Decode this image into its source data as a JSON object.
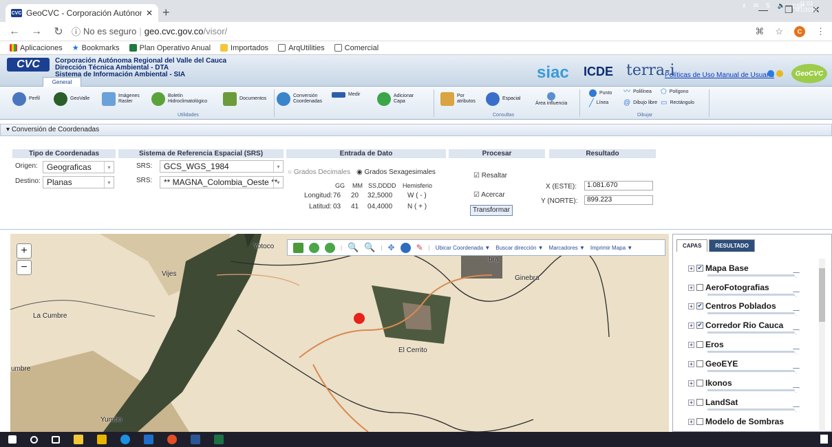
{
  "browser": {
    "tab_title": "GeoCVC - Corporación Autónom",
    "new_tab": "+",
    "security": "No es seguro",
    "url_domain": "geo.cvc.gov.co",
    "url_path": "/visor/",
    "bookmarks": [
      "Aplicaciones",
      "Bookmarks",
      "Plan Operativo Anual",
      "Importados",
      "ArqUtilities",
      "Comercial"
    ],
    "profile_initial": "C"
  },
  "header": {
    "logo": "CVC",
    "org_line1": "Corporación Autónoma Regional del Valle del Cauca",
    "org_line2": "Dirección Técnica Ambiental - DTA",
    "org_line3": "Sistema de Información Ambiental - SIA",
    "tab_general": "General",
    "siac": "siac",
    "icde": "ICDE",
    "terra": "terra-i",
    "link_policies": "Políticas de Uso",
    "link_manual": "Manual de Usuario",
    "geocvc": "GeoCVC"
  },
  "toolbar": {
    "perfil": "Perfil",
    "geovalle": "GeoValle",
    "imagenes": "Imágenes Raster",
    "boletin": "Boletín Hidroclimatológico",
    "documentos": "Documentos",
    "utilidades": "Utilidades",
    "conversion": "Conversión Coordenadas",
    "medir": "Medir",
    "adicionar": "Adicionar Capa",
    "por_atributos": "Por atributos",
    "espacial": "Espacial",
    "consultas": "Consultas",
    "area_influencia": "Área influencia",
    "punto": "Punto",
    "linea": "Línea",
    "polilinea": "Polilínea",
    "dibujo_libre": "Dibujo libre",
    "dibujar": "Dibujar",
    "poligono": "Polígono",
    "rectangulo": "Rectángulo"
  },
  "conversion": {
    "panel_title": "Conversión de Coordenadas",
    "h_tipo": "Tipo de Coordenadas",
    "h_srs": "Sistema de Referencia Espacial (SRS)",
    "h_entrada": "Entrada de Dato",
    "h_procesar": "Procesar",
    "h_resultado": "Resultado",
    "origen_label": "Origen:",
    "origen_value": "Geograficas",
    "destino_label": "Destino:",
    "destino_value": "Planas",
    "srs_label": "SRS:",
    "srs_origen": "GCS_WGS_1984",
    "srs_destino": "** MAGNA_Colombia_Oeste **",
    "opt_decimales": "Grados Decimales",
    "opt_sexagesimales": "Grados Sexagesimales",
    "col_gg": "GG",
    "col_mm": "MM",
    "col_ss": "SS,DDDD",
    "col_hem": "Hemisferio",
    "longitud_label": "Longitud:",
    "lon_gg": "76",
    "lon_mm": "20",
    "lon_ss": "32,5000",
    "lon_hem": "W ( - )",
    "latitud_label": "Latitud:",
    "lat_gg": "03",
    "lat_mm": "41",
    "lat_ss": "04,4000",
    "lat_hem": "N ( + )",
    "resaltar": "Resaltar",
    "acercar": "Acercar",
    "transformar": "Transformar",
    "x_label": "X (ESTE):",
    "x_value": "1.081.670",
    "y_label": "Y (NORTE):",
    "y_value": "899.223"
  },
  "map": {
    "places": {
      "yotoco": "Yotoco",
      "vijes": "Vijes",
      "ginebra": "Ginebra",
      "la_cumbre": "La Cumbre",
      "el_cerrito": "El Cerrito",
      "yumbo": "Yumbo",
      "cumbre_edge": "umbre",
      "bra": "bra"
    },
    "tools": {
      "ubicar": "Ubicar Coordenada ▼",
      "buscar": "Buscar dirección ▼",
      "marcadores": "Marcadores ▼",
      "imprimir": "Imprimir Mapa ▼"
    },
    "zoom_in": "+",
    "zoom_out": "−"
  },
  "layers_panel": {
    "tab_capas": "CAPAS",
    "tab_resultado": "RESULTADO",
    "layers": [
      {
        "name": "Mapa Base",
        "checked": true
      },
      {
        "name": "AeroFotografias",
        "checked": false
      },
      {
        "name": "Centros Poblados",
        "checked": true
      },
      {
        "name": "Corredor Rio Cauca",
        "checked": true
      },
      {
        "name": "Eros",
        "checked": false
      },
      {
        "name": "GeoEYE",
        "checked": false
      },
      {
        "name": "Ikonos",
        "checked": false
      },
      {
        "name": "LandSat",
        "checked": false
      },
      {
        "name": "Modelo de Sombras",
        "checked": false
      }
    ]
  },
  "taskbar": {
    "lang": "ESP",
    "time": "11:03",
    "date": "8/1/2019"
  },
  "colors": {
    "accent_blue": "#1b3f91",
    "map_beige": "#ece0c8",
    "marker_red": "#e8211b"
  }
}
